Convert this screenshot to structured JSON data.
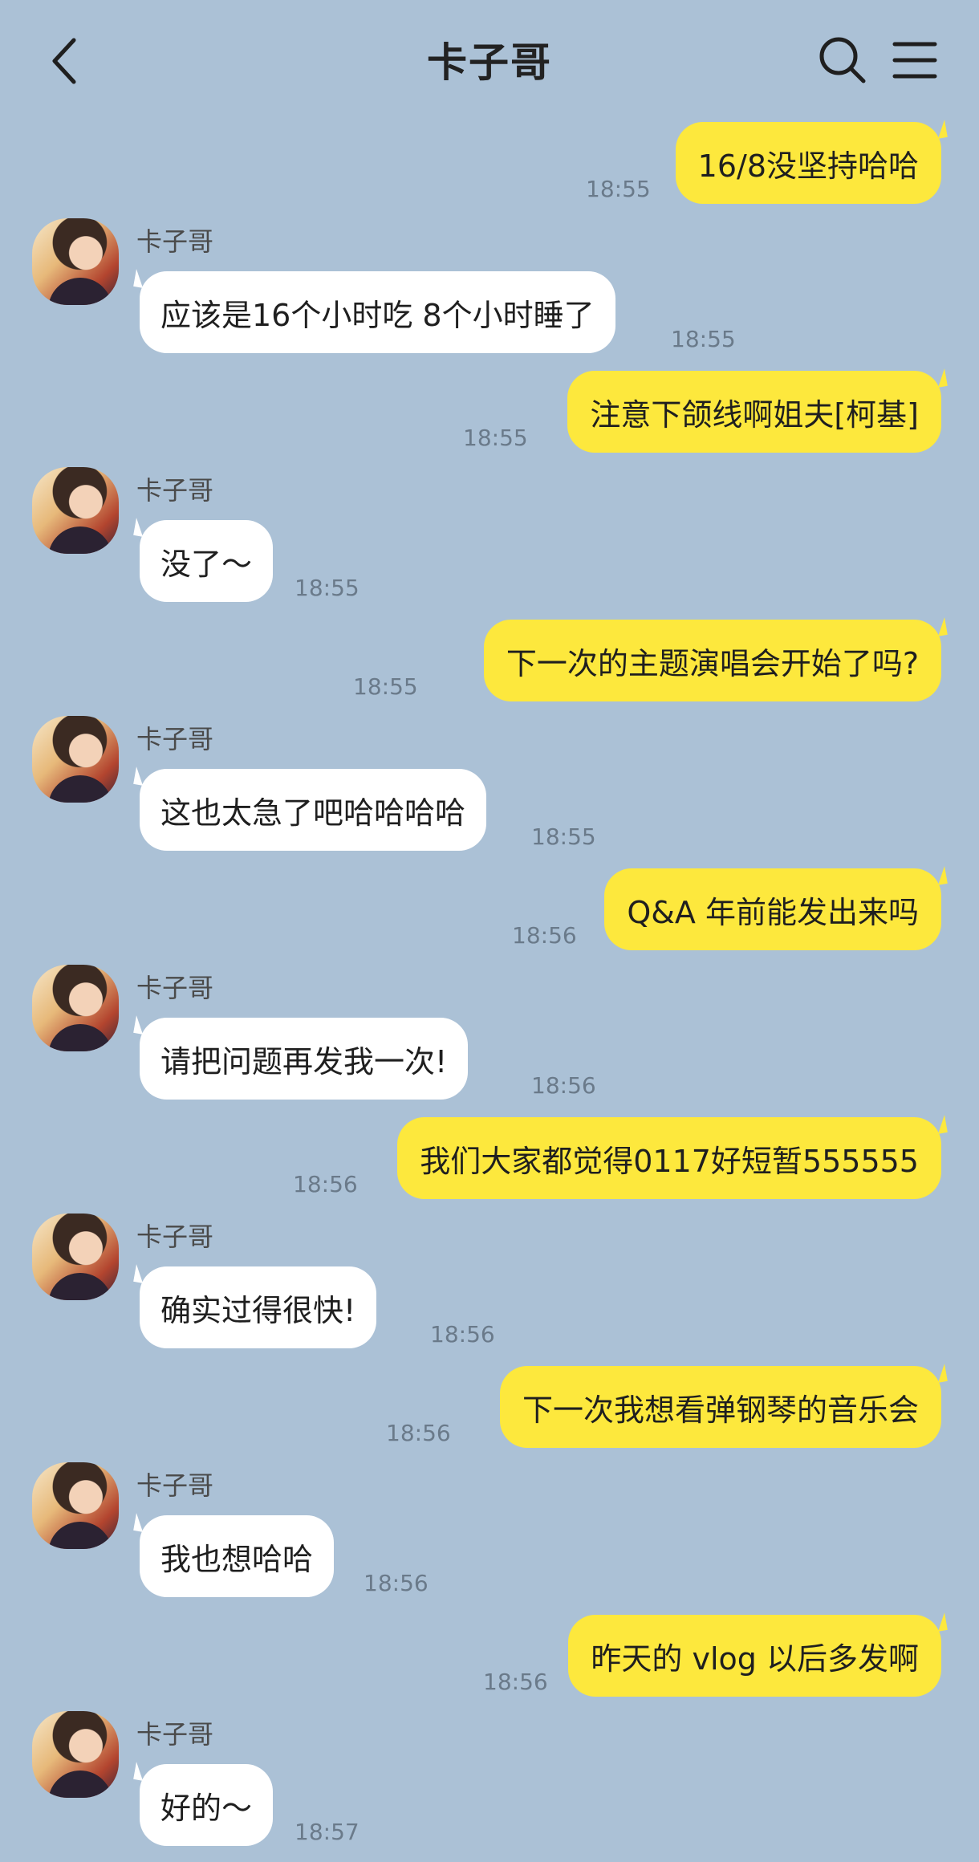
{
  "header": {
    "title": "卡子哥",
    "back_icon": "chevron-left-icon",
    "search_icon": "search-icon",
    "menu_icon": "hamburger-menu-icon"
  },
  "contact": {
    "name": "卡子哥"
  },
  "colors": {
    "background": "#abc1d6",
    "outgoing_bubble": "#fde83d",
    "incoming_bubble": "#ffffff"
  },
  "messages": [
    {
      "direction": "out",
      "text": "16/8没坚持哈哈",
      "time": "18:55"
    },
    {
      "direction": "in",
      "sender": "卡子哥",
      "text": "应该是16个小时吃 8个小时睡了",
      "time": "18:55"
    },
    {
      "direction": "out",
      "text": "注意下颌线啊姐夫[柯基]",
      "time": "18:55"
    },
    {
      "direction": "in",
      "sender": "卡子哥",
      "text": "没了～",
      "time": "18:55"
    },
    {
      "direction": "out",
      "text": "下一次的主题演唱会开始了吗?",
      "time": "18:55"
    },
    {
      "direction": "in",
      "sender": "卡子哥",
      "text": "这也太急了吧哈哈哈哈",
      "time": "18:55"
    },
    {
      "direction": "out",
      "text": "Q&A 年前能发出来吗",
      "time": "18:56"
    },
    {
      "direction": "in",
      "sender": "卡子哥",
      "text": "请把问题再发我一次!",
      "time": "18:56"
    },
    {
      "direction": "out",
      "text": "我们大家都觉得0117好短暂555555",
      "time": "18:56"
    },
    {
      "direction": "in",
      "sender": "卡子哥",
      "text": "确实过得很快!",
      "time": "18:56"
    },
    {
      "direction": "out",
      "text": "下一次我想看弹钢琴的音乐会",
      "time": "18:56"
    },
    {
      "direction": "in",
      "sender": "卡子哥",
      "text": "我也想哈哈",
      "time": "18:56"
    },
    {
      "direction": "out",
      "text": "昨天的 vlog 以后多发啊",
      "time": "18:56"
    },
    {
      "direction": "in",
      "sender": "卡子哥",
      "text": "好的～",
      "time": "18:57"
    }
  ]
}
